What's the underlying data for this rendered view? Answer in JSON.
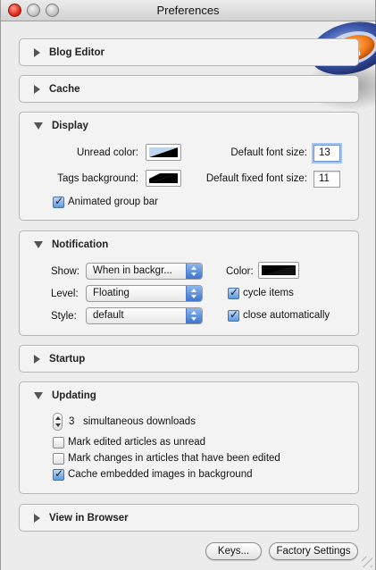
{
  "window": {
    "title": "Preferences"
  },
  "panels": {
    "blog_editor": {
      "title": "Blog Editor"
    },
    "cache": {
      "title": "Cache"
    },
    "display": {
      "title": "Display",
      "unread_color_label": "Unread color:",
      "tags_background_label": "Tags background:",
      "default_font_size_label": "Default font size:",
      "default_font_size_value": "13",
      "default_fixed_font_size_label": "Default fixed font size:",
      "default_fixed_font_size_value": "11",
      "animated_group_bar_label": "Animated group bar",
      "animated_group_bar_checked": true,
      "unread_color": "#bcd6f0",
      "tags_background_color": "#000000"
    },
    "notification": {
      "title": "Notification",
      "show_label": "Show:",
      "show_value": "When in backgr...",
      "level_label": "Level:",
      "level_value": "Floating",
      "style_label": "Style:",
      "style_value": "default",
      "color_label": "Color:",
      "color_value": "#000000",
      "cycle_items_label": "cycle items",
      "cycle_items_checked": true,
      "close_automatically_label": "close automatically",
      "close_automatically_checked": true
    },
    "startup": {
      "title": "Startup"
    },
    "updating": {
      "title": "Updating",
      "simultaneous_downloads_value": "3",
      "simultaneous_downloads_label": "simultaneous downloads",
      "mark_edited_label": "Mark edited articles as unread",
      "mark_edited_checked": false,
      "mark_changes_label": "Mark changes in articles that have been edited",
      "mark_changes_checked": false,
      "cache_images_label": "Cache embedded images in background",
      "cache_images_checked": true
    },
    "view_in_browser": {
      "title": "View in Browser"
    }
  },
  "footer": {
    "keys_button": "Keys...",
    "factory_settings_button": "Factory Settings"
  }
}
